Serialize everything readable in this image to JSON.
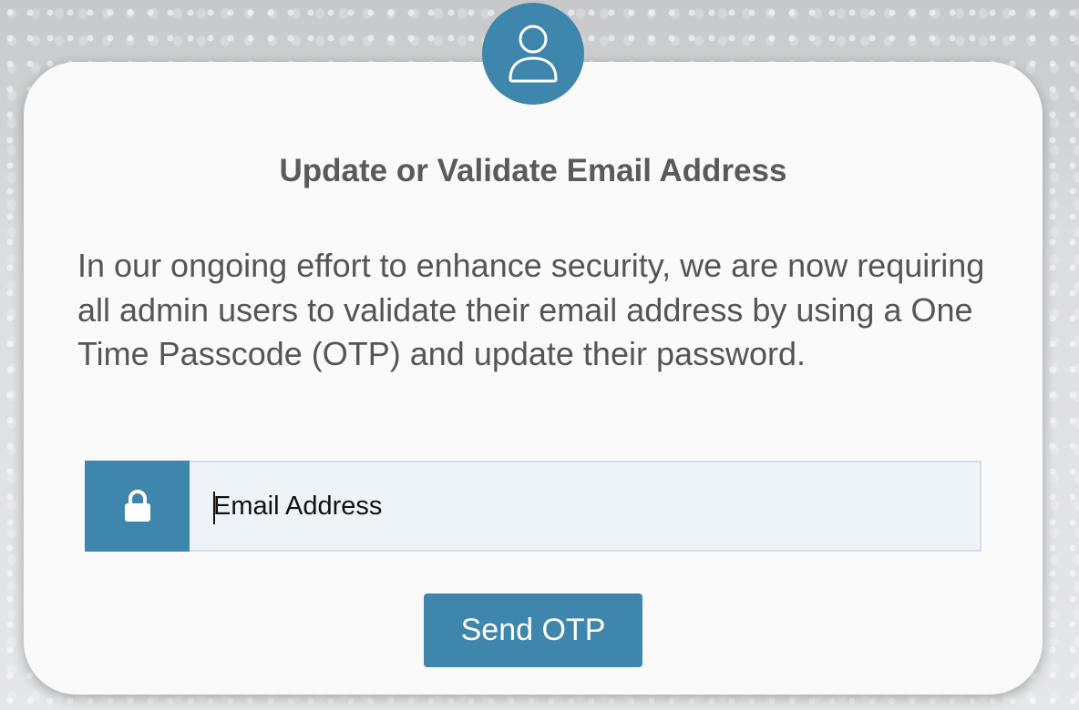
{
  "dialog": {
    "title": "Update or Validate Email Address",
    "message": "In our ongoing effort to enhance security, we are now requiring all admin users to validate their email address by using a One Time Passcode (OTP) and update their password.",
    "email_field": {
      "placeholder": "Email Address",
      "value": "",
      "icon": "lock-icon"
    },
    "send_button_label": "Send OTP",
    "avatar_icon": "user-icon"
  },
  "colors": {
    "accent": "#3f86ad",
    "card_background": "#fafafa",
    "title_text": "#5a5a5a",
    "body_text": "#555555",
    "input_background": "#eef3f8"
  }
}
